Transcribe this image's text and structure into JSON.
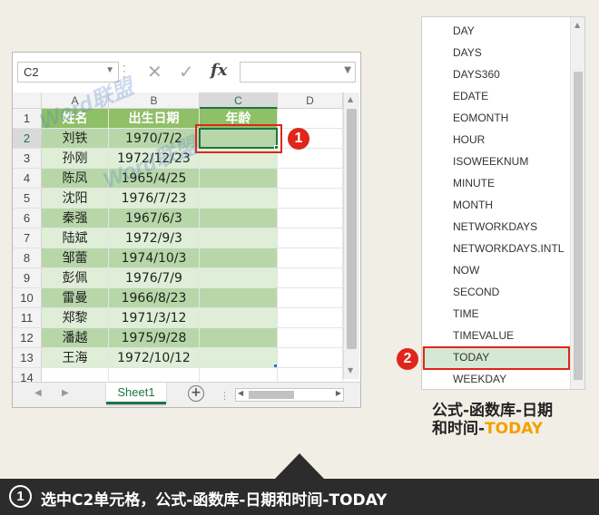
{
  "formula_bar": {
    "name_box": "C2",
    "cancel_icon": "✕",
    "enter_icon": "✓",
    "fx_label": "fx",
    "formula_value": ""
  },
  "columns": [
    "A",
    "B",
    "C",
    "D"
  ],
  "selected_column": "C",
  "selected_row": "2",
  "row_numbers": [
    "1",
    "2",
    "3",
    "4",
    "5",
    "6",
    "7",
    "8",
    "9",
    "10",
    "11",
    "12",
    "13",
    "14"
  ],
  "table": {
    "headers": [
      "姓名",
      "出生日期",
      "年龄"
    ],
    "rows": [
      [
        "刘铁",
        "1970/7/2"
      ],
      [
        "孙刚",
        "1972/12/23"
      ],
      [
        "陈凤",
        "1965/4/25"
      ],
      [
        "沈阳",
        "1976/7/23"
      ],
      [
        "秦强",
        "1967/6/3"
      ],
      [
        "陆斌",
        "1972/9/3"
      ],
      [
        "邹蕾",
        "1974/10/3"
      ],
      [
        "彭佩",
        "1976/7/9"
      ],
      [
        "雷曼",
        "1966/8/23"
      ],
      [
        "郑黎",
        "1971/3/12"
      ],
      [
        "潘越",
        "1975/9/28"
      ],
      [
        "王海",
        "1972/10/12"
      ]
    ]
  },
  "sheet_tab": "Sheet1",
  "watermark": "Word联盟",
  "function_list": [
    "DAY",
    "DAYS",
    "DAYS360",
    "EDATE",
    "EOMONTH",
    "HOUR",
    "ISOWEEKNUM",
    "MINUTE",
    "MONTH",
    "NETWORKDAYS",
    "NETWORKDAYS.INTL",
    "NOW",
    "SECOND",
    "TIME",
    "TIMEVALUE",
    "TODAY",
    "WEEKDAY"
  ],
  "highlighted_function": "TODAY",
  "caption": {
    "line1": "公式-函数库-日期",
    "line2_prefix": "和时间-",
    "line2_highlight": "TODAY"
  },
  "badges": {
    "one": "1",
    "two": "2"
  },
  "step": {
    "number": "1",
    "text": "选中C2单元格，公式-函数库-日期和时间-TODAY"
  },
  "colors": {
    "header_green": "#8fbf67",
    "dark_green_fill": "#b7d7a8",
    "light_green_fill": "#dfeed6",
    "accent_red": "#e0251b",
    "excel_green": "#217346",
    "caption_orange": "#f5a000"
  }
}
